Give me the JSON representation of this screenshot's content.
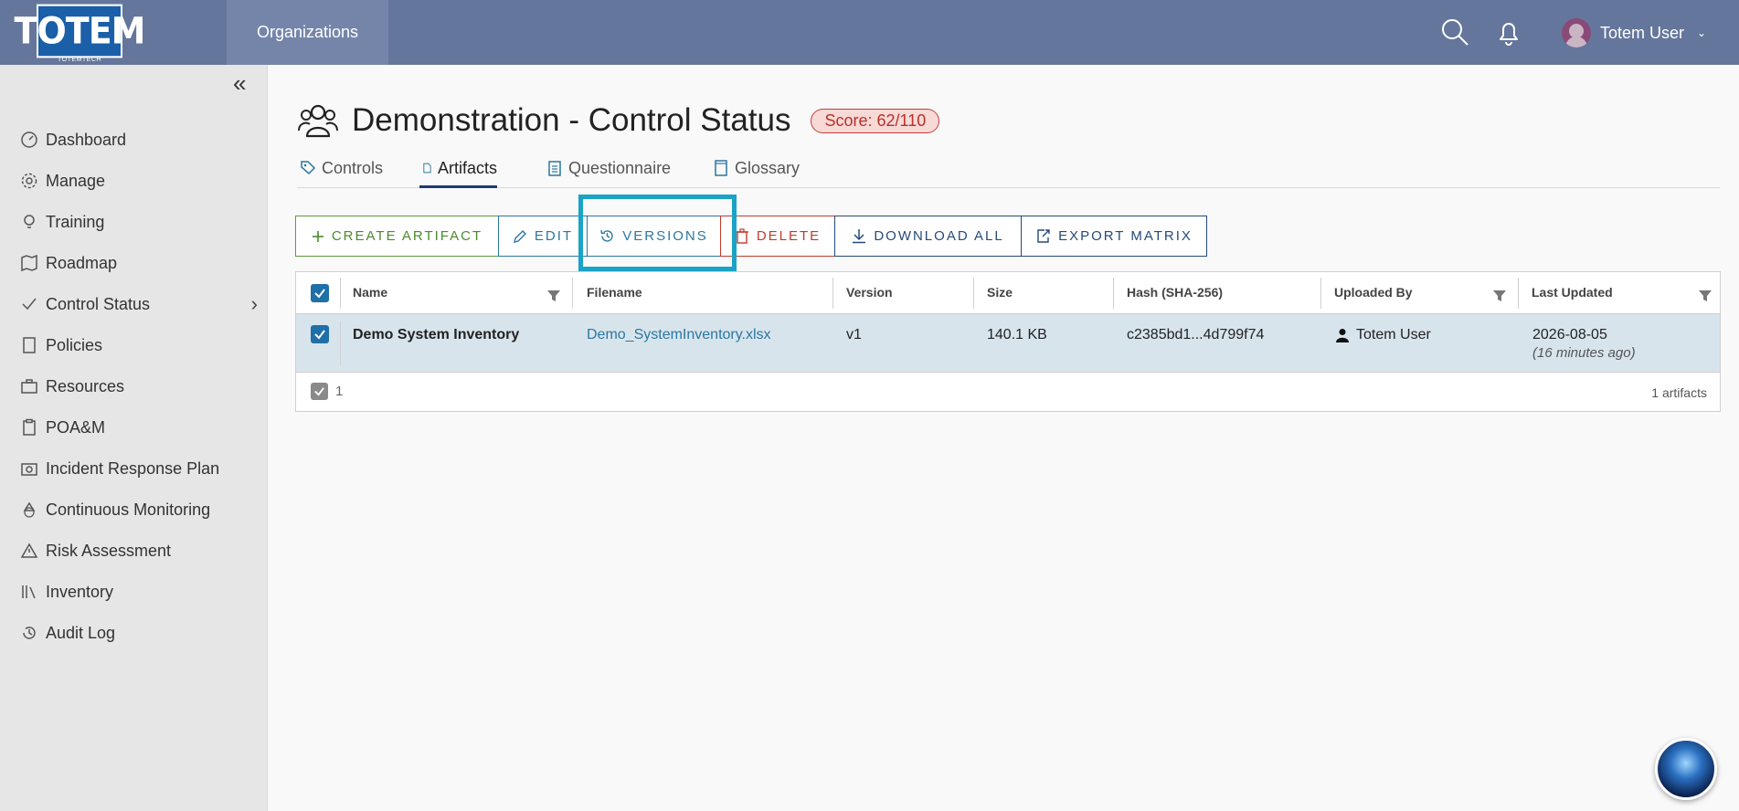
{
  "topbar": {
    "logo_text": "TOTEM",
    "logo_sub": "TOTEMTECH",
    "nav_label": "Organizations",
    "user_name": "Totem User",
    "icons": [
      "search-icon",
      "bell-icon",
      "chevron-down-icon"
    ]
  },
  "sidebar": {
    "items": [
      {
        "label": "Dashboard",
        "icon": "dashboard-icon"
      },
      {
        "label": "Manage",
        "icon": "gear-icon"
      },
      {
        "label": "Training",
        "icon": "lightbulb-icon"
      },
      {
        "label": "Roadmap",
        "icon": "map-icon"
      },
      {
        "label": "Control Status",
        "icon": "check-icon"
      },
      {
        "label": "Policies",
        "icon": "document-icon"
      },
      {
        "label": "Resources",
        "icon": "briefcase-icon"
      },
      {
        "label": "POA&M",
        "icon": "clipboard-icon"
      },
      {
        "label": "Incident Response Plan",
        "icon": "camera-icon"
      },
      {
        "label": "Continuous Monitoring",
        "icon": "recycle-icon"
      },
      {
        "label": "Risk Assessment",
        "icon": "warning-icon"
      },
      {
        "label": "Inventory",
        "icon": "library-icon"
      },
      {
        "label": "Audit Log",
        "icon": "history-icon"
      }
    ]
  },
  "page": {
    "title": "Demonstration - Control Status",
    "score": "Score: 62/110"
  },
  "tabs": [
    {
      "label": "Controls",
      "icon": "tag-icon"
    },
    {
      "label": "Artifacts",
      "icon": "file-icon",
      "active": true
    },
    {
      "label": "Questionnaire",
      "icon": "clipboard-icon"
    },
    {
      "label": "Glossary",
      "icon": "book-icon"
    }
  ],
  "toolbar": {
    "create": "Create Artifact",
    "edit": "Edit",
    "versions": "Versions",
    "delete": "Delete",
    "download_all": "Download All",
    "export_matrix": "Export Matrix"
  },
  "table": {
    "columns": [
      "Name",
      "Filename",
      "Version",
      "Size",
      "Hash (SHA-256)",
      "Uploaded By",
      "Last Updated"
    ],
    "rows": [
      {
        "name": "Demo System Inventory",
        "filename": "Demo_SystemInventory.xlsx",
        "version": "v1",
        "size": "140.1 KB",
        "hash": "c2385bd1...4d799f74",
        "uploaded_by": "Totem User",
        "last_updated": "2026-08-05",
        "last_updated_relative": "(16 minutes ago)"
      }
    ],
    "selected_count": "1",
    "total_label": "1 artifacts"
  },
  "colors": {
    "topbar": "#65769c",
    "accent_blue": "#2a77a0",
    "create_green": "#4a8a2a",
    "delete_red": "#c33a2b",
    "highlight": "#1aa3c6"
  }
}
